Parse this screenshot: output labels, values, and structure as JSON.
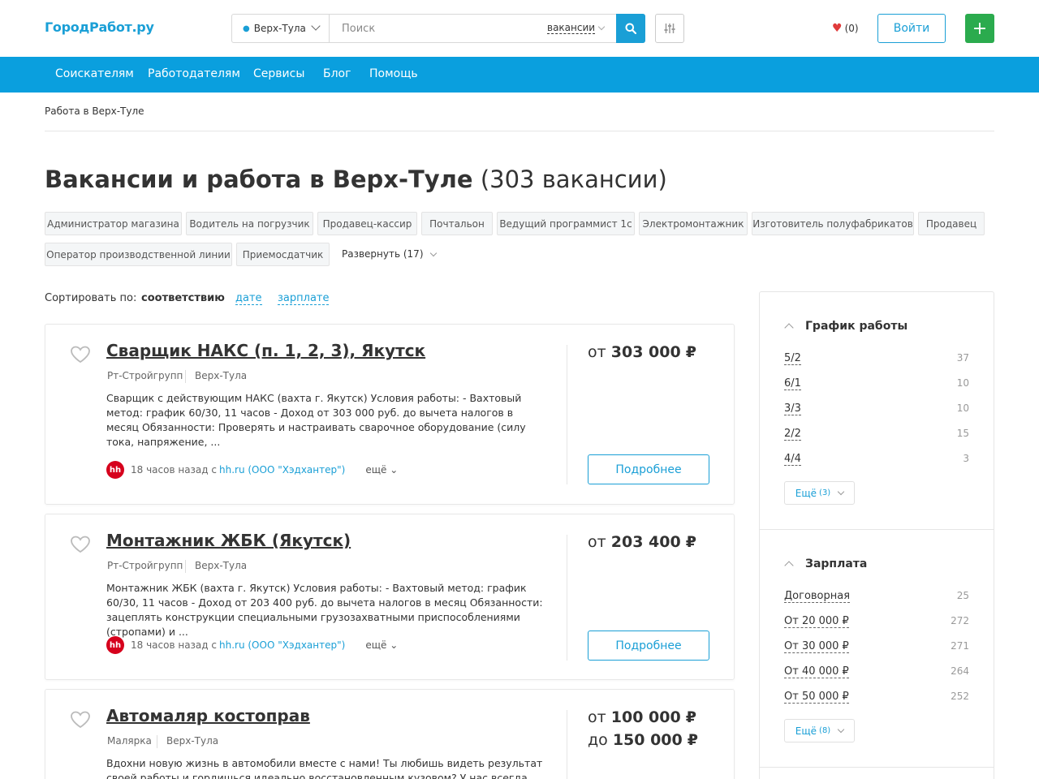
{
  "header": {
    "logo": "ГородРабот.ру",
    "city": "Верх-Тула",
    "search_placeholder": "Поиск",
    "search_type": "вакансии",
    "favorites_count": "(0)",
    "login_label": "Войти",
    "add_label": "+"
  },
  "nav": {
    "items": [
      "Соискателям",
      "Работодателям",
      "Сервисы",
      "Блог",
      "Помощь"
    ]
  },
  "breadcrumb": "Работа в Верх-Туле",
  "page_title": "Вакансии и работа в Верх-Туле",
  "vacancy_count": "(303 вакансии)",
  "tags": [
    "Администратор магазина",
    "Водитель на погрузчик",
    "Продавец-кассир",
    "Почтальон",
    "Ведущий программист 1с",
    "Электромонтажник",
    "Изготовитель полуфабрикатов",
    "Продавец",
    "Оператор производственной линии",
    "Приемосдатчик"
  ],
  "expand_label": "Развернуть (17)",
  "sort": {
    "label": "Сортировать по:",
    "active": "соответствию",
    "options": [
      "дате",
      "зарплате"
    ]
  },
  "vacancies": [
    {
      "title": "Сварщик НАКС (п. 1, 2, 3), Якутск",
      "company": "Рт-Стройгрупп",
      "city": "Верх-Тула",
      "description": "Сварщик с действующим НАКС (вахта г. Якутск) Условия работы: - Вахтовый метод: график 60/30, 11 часов - Доход от 303 000 руб. до вычета налогов в месяц Обязанности: Проверять и настраивать сварочное оборудование (силу тока, напряжение, ...",
      "source_badge": "hh",
      "posted": "18 часов назад с",
      "source": "hh.ru (ООО \"Хэдхантер\")",
      "more": "ещё",
      "salary_from_prefix": "от",
      "salary_from": "303 000",
      "currency": "₽",
      "details_label": "Подробнее"
    },
    {
      "title": "Монтажник ЖБК (Якутск)",
      "company": "Рт-Стройгрупп",
      "city": "Верх-Тула",
      "description": "Монтажник ЖБК (вахта г. Якутск) Условия работы: - Вахтовый метод: график 60/30, 11 часов - Доход от 203 400 руб. до вычета налогов в месяц Обязанности: зацеплять конструкции специальными грузозахватными приспособлениями (стропами) и ...",
      "source_badge": "hh",
      "posted": "18 часов назад с",
      "source": "hh.ru (ООО \"Хэдхантер\")",
      "more": "ещё",
      "salary_from_prefix": "от",
      "salary_from": "203 400",
      "currency": "₽",
      "details_label": "Подробнее"
    },
    {
      "title": "Автомаляр костоправ",
      "company": "Малярка",
      "city": "Верх-Тула",
      "description": "Вдохни новую жизнь в автомобили вместе с нами! Ты любишь видеть результат своей работы и гордишься идеально восстановленным кузовом? У нас всегда есть",
      "salary_from_prefix": "от",
      "salary_from": "100 000",
      "salary_to_prefix": "до",
      "salary_to": "150 000",
      "currency": "₽"
    }
  ],
  "sidebar": {
    "schedule_title": "График работы",
    "schedule": [
      {
        "label": "5/2",
        "count": "37"
      },
      {
        "label": "6/1",
        "count": "10"
      },
      {
        "label": "3/3",
        "count": "10"
      },
      {
        "label": "2/2",
        "count": "15"
      },
      {
        "label": "4/4",
        "count": "3"
      }
    ],
    "schedule_more": "Ещё",
    "schedule_more_count": "(3)",
    "salary_title": "Зарплата",
    "salary": [
      {
        "label": "Договорная",
        "count": "25"
      },
      {
        "label": "От 20 000 ₽",
        "count": "272"
      },
      {
        "label": "От 30 000 ₽",
        "count": "271"
      },
      {
        "label": "От 40 000 ₽",
        "count": "264"
      },
      {
        "label": "От 50 000 ₽",
        "count": "252"
      }
    ],
    "salary_more": "Ещё",
    "salary_more_count": "(8)"
  },
  "colors": {
    "accent": "#1a9fd6",
    "nav_bg": "#0a9fde",
    "add_button": "#2bab4e",
    "favorite": "#e03b3b",
    "hh_badge": "#d6001c"
  },
  "icons": [
    "location-pin-icon",
    "chevron-down-icon",
    "search-icon",
    "filter-sliders-icon",
    "heart-icon",
    "heart-outline-icon",
    "plus-icon"
  ]
}
